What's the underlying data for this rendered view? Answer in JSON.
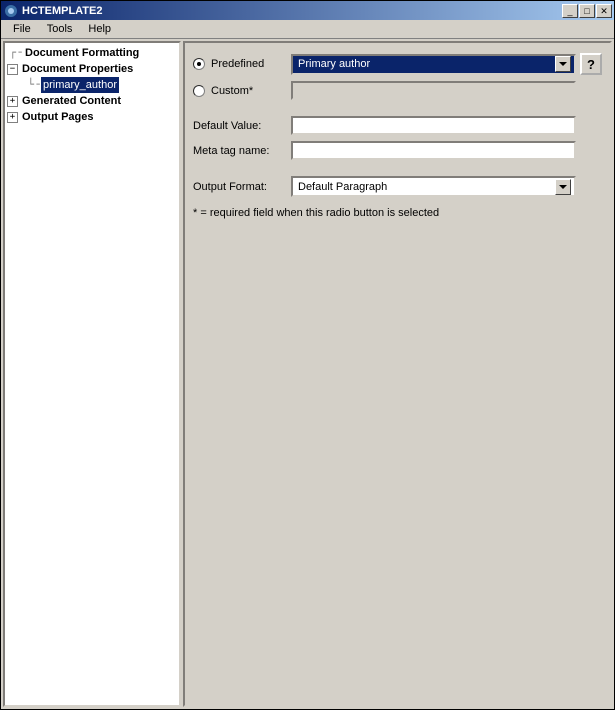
{
  "title": "HCTEMPLATE2",
  "menu": {
    "file": "File",
    "tools": "Tools",
    "help": "Help"
  },
  "tree": {
    "docFormatting": "Document Formatting",
    "docProperties": "Document Properties",
    "primaryAuthor": "primary_author",
    "generatedContent": "Generated Content",
    "outputPages": "Output Pages"
  },
  "form": {
    "predefinedLabel": "Predefined",
    "predefinedValue": "Primary author",
    "customLabel": "Custom*",
    "customValue": "",
    "defaultValueLabel": "Default Value:",
    "defaultValue": "",
    "metaTagLabel": "Meta tag name:",
    "metaTagValue": "",
    "outputFormatLabel": "Output Format:",
    "outputFormatValue": "Default Paragraph",
    "note": "* = required field when this radio button is selected",
    "helpLabel": "?"
  }
}
